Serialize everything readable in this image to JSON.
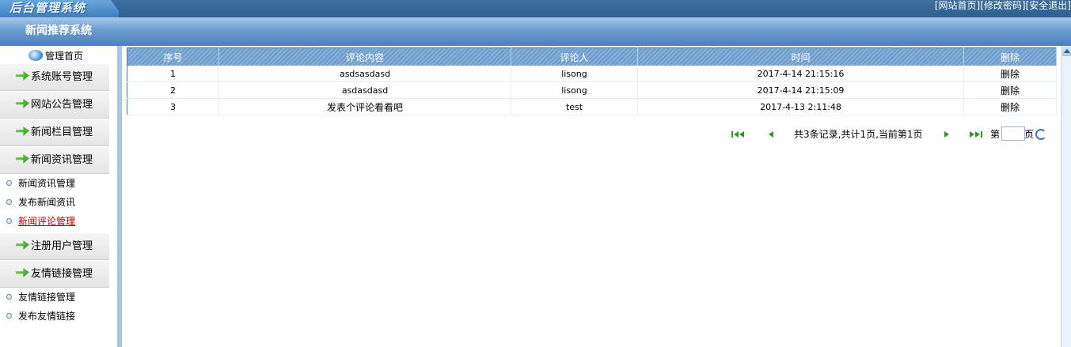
{
  "header": {
    "logo_text": "后台管理系统",
    "links": [
      "[网站首页]",
      "[修改密码]",
      "[安全退出]"
    ]
  },
  "section_title": "新闻推荐系统",
  "sidebar": {
    "home_label": "管理首页",
    "groups": [
      {
        "label": "系统账号管理"
      },
      {
        "label": "网站公告管理"
      },
      {
        "label": "新闻栏目管理"
      },
      {
        "label": "新闻资讯管理",
        "items": [
          "新闻资讯管理",
          "发布新闻资讯",
          "新闻评论管理"
        ]
      },
      {
        "label": "注册用户管理"
      },
      {
        "label": "友情链接管理",
        "items": [
          "友情链接管理",
          "发布友情链接"
        ]
      }
    ],
    "active_item": "新闻评论管理"
  },
  "table": {
    "columns": [
      "序号",
      "评论内容",
      "评论人",
      "时间",
      "删除"
    ],
    "rows": [
      [
        "1",
        "asdsasdasd",
        "lisong",
        "2017-4-14 21:15:16",
        "删除"
      ],
      [
        "2",
        "asdasdasd",
        "lisong",
        "2017-4-14 21:15:09",
        "删除"
      ],
      [
        "3",
        "发表个评论看看吧",
        "test",
        "2017-4-13 2:11:48",
        "删除"
      ]
    ]
  },
  "pager": {
    "summary": "共3条记录,共计1页,当前第1页",
    "goto_prefix": "第",
    "goto_suffix": "页",
    "page_value": ""
  }
}
